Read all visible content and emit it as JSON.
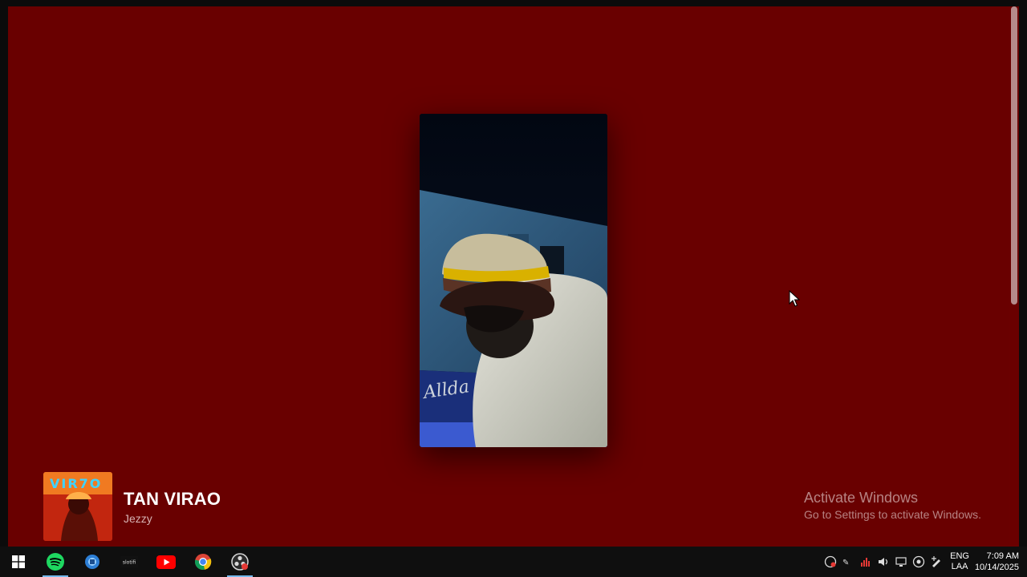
{
  "now_playing": {
    "title": "TAN VIRAO",
    "artist": "Jezzy"
  },
  "watermark": {
    "title": "Activate Windows",
    "subtitle": "Go to Settings to activate Windows."
  },
  "taskbar": {
    "apps": [
      {
        "name": "start-button",
        "icon": "windows-icon",
        "active": false
      },
      {
        "name": "spotify-button",
        "icon": "spotify-icon",
        "active": true
      },
      {
        "name": "browser-button",
        "icon": "browser-icon",
        "active": false
      },
      {
        "name": "slotify-button",
        "icon": "slotify-icon",
        "active": false
      },
      {
        "name": "youtube-button",
        "icon": "youtube-icon",
        "active": false
      },
      {
        "name": "chrome-button",
        "icon": "chrome-icon",
        "active": false
      },
      {
        "name": "obs-button",
        "icon": "obs-icon",
        "active": true
      }
    ],
    "slotify_label": "slotifi",
    "language": {
      "line1": "ENG",
      "line2": "LAA"
    },
    "clock": {
      "time": "7:09 AM",
      "date": "10/14/2025"
    }
  },
  "colors": {
    "background": "#690000",
    "taskbar": "#0f0f0f",
    "accent": "#76b9ed"
  }
}
